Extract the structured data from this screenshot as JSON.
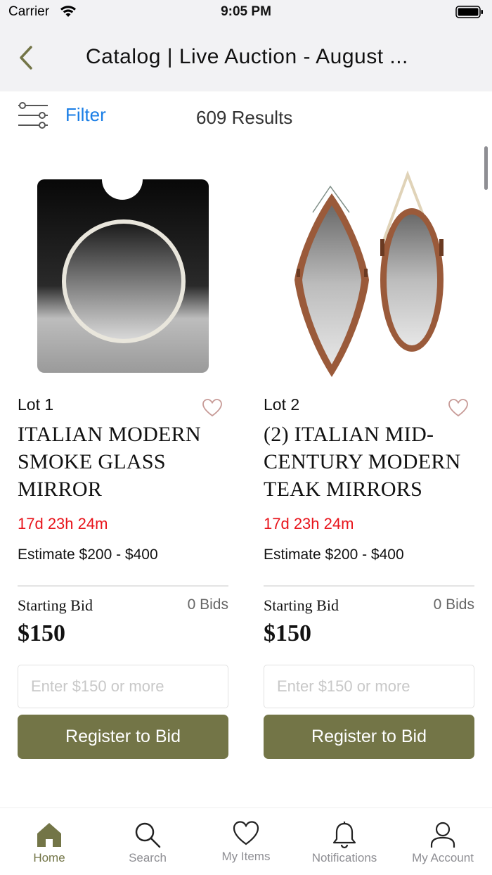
{
  "status_bar": {
    "carrier": "Carrier",
    "time": "9:05 PM"
  },
  "nav": {
    "title": "Catalog | Live Auction - August ..."
  },
  "filter": {
    "label": "Filter",
    "results": "609 Results"
  },
  "lots": [
    {
      "lot": "Lot 1",
      "title": "ITALIAN MODERN SMOKE GLASS MIRROR",
      "time_left": "17d 23h 24m",
      "estimate": "Estimate $200 - $400",
      "bid_label": "Starting Bid",
      "bid_count": "0 Bids",
      "bid_amount": "$150",
      "input_placeholder": "Enter $150 or more",
      "button_label": "Register to Bid"
    },
    {
      "lot": "Lot 2",
      "title": "(2) ITALIAN MID-CENTURY MODERN TEAK MIRRORS",
      "time_left": "17d 23h 24m",
      "estimate": "Estimate $200 - $400",
      "bid_label": "Starting Bid",
      "bid_count": "0 Bids",
      "bid_amount": "$150",
      "input_placeholder": "Enter $150 or more",
      "button_label": "Register to Bid"
    }
  ],
  "tabs": [
    {
      "label": "Home",
      "icon": "home-icon",
      "active": true
    },
    {
      "label": "Search",
      "icon": "search-icon",
      "active": false
    },
    {
      "label": "My Items",
      "icon": "heart-icon",
      "active": false
    },
    {
      "label": "Notifications",
      "icon": "bell-icon",
      "active": false
    },
    {
      "label": "My Account",
      "icon": "person-icon",
      "active": false
    }
  ],
  "colors": {
    "accent": "#737547",
    "link": "#1a7ee6",
    "countdown": "#e8141b",
    "header_bg": "#f2f2f4"
  }
}
